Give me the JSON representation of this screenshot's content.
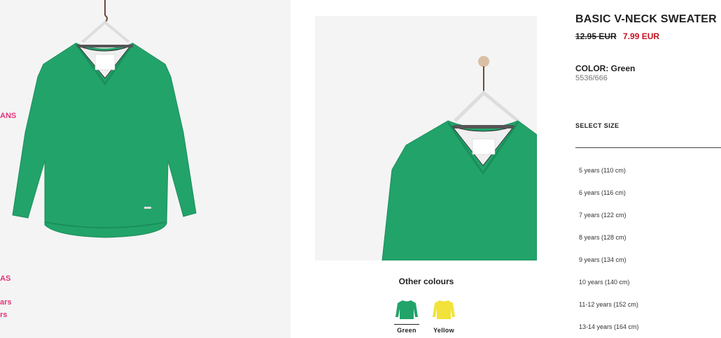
{
  "sidebar": {
    "links": [
      "ANS",
      "AS",
      "ars",
      "rs"
    ]
  },
  "product": {
    "title": "BASIC V-NECK SWEATER",
    "old_price": "12.95 EUR",
    "new_price": "7.99 EUR",
    "color_label": "COLOR: Green",
    "reference": "5536/666"
  },
  "other_colours": {
    "heading": "Other colours",
    "options": [
      {
        "label": "Green",
        "color": "#22a36a"
      },
      {
        "label": "Yellow",
        "color": "#f2e23a"
      }
    ]
  },
  "size_selector": {
    "label": "SELECT SIZE",
    "sizes": [
      "5 years (110 cm)",
      "6 years (116 cm)",
      "7 years (122 cm)",
      "8 years (128 cm)",
      "9 years (134 cm)",
      "10 years (140 cm)",
      "11-12 years (152 cm)",
      "13-14 years (164 cm)"
    ]
  },
  "colors": {
    "sweater": "#22a36a",
    "sweater_shade": "#1b8f5c",
    "sale_red": "#c4121f",
    "accent_pink": "#e0347a"
  }
}
